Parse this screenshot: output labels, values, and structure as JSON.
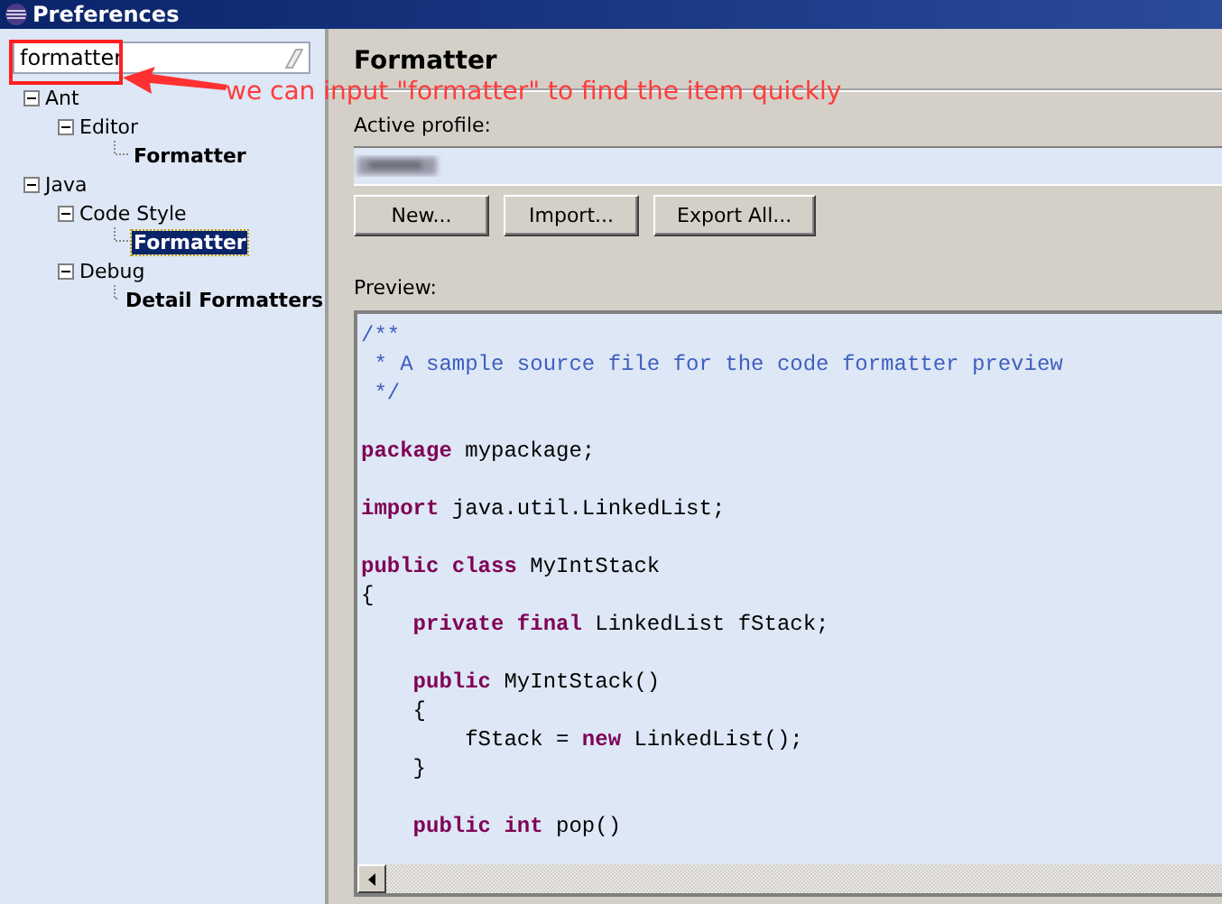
{
  "window": {
    "title": "Preferences"
  },
  "filter": {
    "value": "formatter"
  },
  "tree": [
    {
      "label": "Ant",
      "expanded": true,
      "match": false,
      "selected": false,
      "children": [
        {
          "label": "Editor",
          "expanded": true,
          "match": false,
          "selected": false,
          "children": [
            {
              "label": "Formatter",
              "match": true,
              "selected": false
            }
          ]
        }
      ]
    },
    {
      "label": "Java",
      "expanded": true,
      "match": false,
      "selected": false,
      "children": [
        {
          "label": "Code Style",
          "expanded": true,
          "match": false,
          "selected": false,
          "children": [
            {
              "label": "Formatter",
              "match": true,
              "selected": true
            }
          ]
        },
        {
          "label": "Debug",
          "expanded": true,
          "match": false,
          "selected": false,
          "children": [
            {
              "label": "Detail Formatters",
              "match": true,
              "selected": false
            }
          ]
        }
      ]
    }
  ],
  "page": {
    "title": "Formatter",
    "profile_label": "Active profile:",
    "buttons": [
      "New...",
      "Import...",
      "Export All..."
    ],
    "preview_label": "Preview:"
  },
  "preview": [
    {
      "kind": "code",
      "segments": [
        {
          "kind": "comment",
          "text": "/**"
        }
      ]
    },
    {
      "kind": "code",
      "segments": [
        {
          "kind": "comment",
          "text": " * A sample source file for the code formatter preview"
        }
      ]
    },
    {
      "kind": "code",
      "segments": [
        {
          "kind": "comment",
          "text": " */"
        }
      ]
    },
    {
      "kind": "blank"
    },
    {
      "kind": "code",
      "segments": [
        {
          "kind": "keyword",
          "text": "package"
        },
        {
          "kind": "plain",
          "text": " mypackage;"
        }
      ]
    },
    {
      "kind": "blank"
    },
    {
      "kind": "code",
      "segments": [
        {
          "kind": "keyword",
          "text": "import"
        },
        {
          "kind": "plain",
          "text": " java.util.LinkedList;"
        }
      ]
    },
    {
      "kind": "blank"
    },
    {
      "kind": "code",
      "segments": [
        {
          "kind": "keyword",
          "text": "public class"
        },
        {
          "kind": "plain",
          "text": " MyIntStack"
        }
      ]
    },
    {
      "kind": "code",
      "segments": [
        {
          "kind": "plain",
          "text": "{"
        }
      ]
    },
    {
      "kind": "code",
      "segments": [
        {
          "kind": "keyword",
          "text": "    private final"
        },
        {
          "kind": "plain",
          "text": " LinkedList fStack;"
        }
      ]
    },
    {
      "kind": "blank"
    },
    {
      "kind": "code",
      "segments": [
        {
          "kind": "keyword",
          "text": "    public"
        },
        {
          "kind": "plain",
          "text": " MyIntStack()"
        }
      ]
    },
    {
      "kind": "code",
      "segments": [
        {
          "kind": "plain",
          "text": "    {"
        }
      ]
    },
    {
      "kind": "code",
      "segments": [
        {
          "kind": "plain",
          "text": "        fStack = "
        },
        {
          "kind": "keyword",
          "text": "new"
        },
        {
          "kind": "plain",
          "text": " LinkedList();"
        }
      ]
    },
    {
      "kind": "code",
      "segments": [
        {
          "kind": "plain",
          "text": "    }"
        }
      ]
    },
    {
      "kind": "blank"
    },
    {
      "kind": "code",
      "segments": [
        {
          "kind": "keyword",
          "text": "    public int"
        },
        {
          "kind": "plain",
          "text": " pop()"
        }
      ]
    }
  ],
  "annotation": {
    "text": "we can input \"formatter\" to find the item quickly"
  }
}
